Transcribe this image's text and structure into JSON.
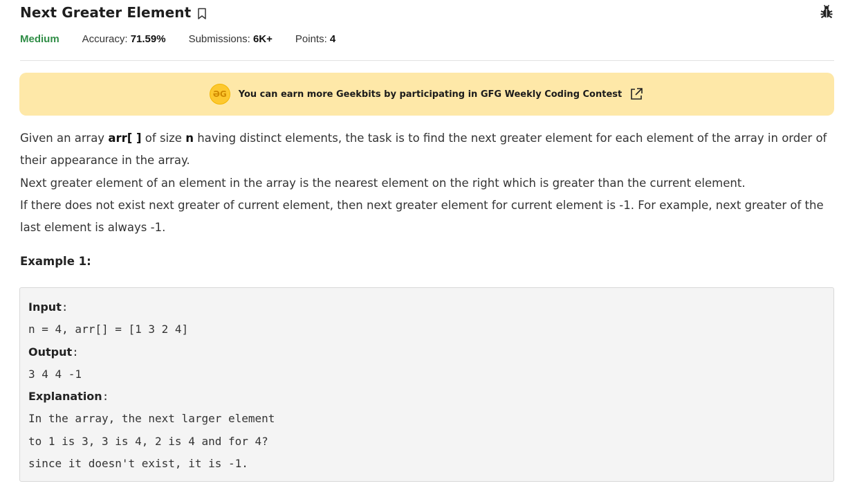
{
  "problem": {
    "title": "Next Greater Element",
    "difficulty": "Medium",
    "accuracy_label": "Accuracy:",
    "accuracy_value": "71.59%",
    "submissions_label": "Submissions:",
    "submissions_value": "6K+",
    "points_label": "Points:",
    "points_value": "4"
  },
  "banner": {
    "coin_text": "ƏG",
    "text": "You can earn more Geekbits by participating in GFG Weekly Coding Contest"
  },
  "description": {
    "p1_a": "Given an array ",
    "p1_b": "arr[ ]",
    "p1_c": " of size ",
    "p1_d": "n",
    "p1_e": " having distinct elements, the task is to find the next greater element for each element of the array in order of their appearance in the array.",
    "p2": "Next greater element of an element in the array is the nearest element on the right which is greater than the current element.",
    "p3": "If there does not exist next greater of current element, then next greater element for current element is -1. For example, next greater of the last element is always -1."
  },
  "example": {
    "title": "Example 1:",
    "input_label": "Input",
    "input_value": "n = 4, arr[] = [1 3 2 4]",
    "output_label": "Output",
    "output_value": "3 4 4 -1",
    "explanation_label": "Explanation",
    "explanation_lines": [
      "In the array, the next larger element",
      "to 1 is 3, 3 is 4, 2 is 4 and for 4?",
      "since it doesn't exist, it is -1."
    ]
  },
  "colors": {
    "difficulty": "#2f8d46",
    "banner_bg": "#fee8a8",
    "coin": "#fdc82f",
    "example_bg": "#f4f4f4"
  },
  "icons": {
    "bookmark": "bookmark-icon",
    "bug": "bug-icon",
    "coin": "geekbits-coin-icon",
    "external": "external-link-icon"
  }
}
